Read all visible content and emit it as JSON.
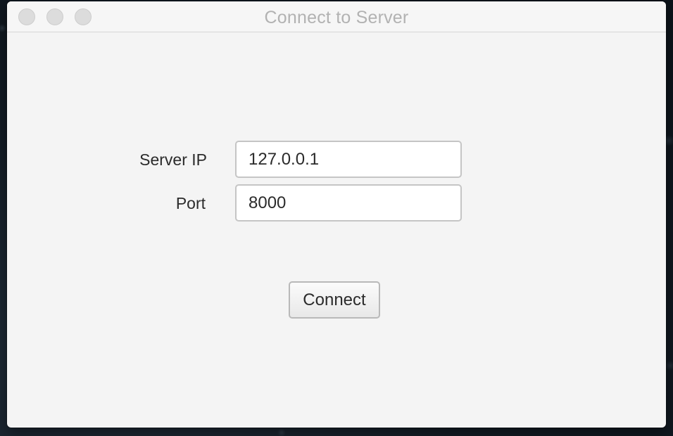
{
  "window": {
    "title": "Connect to Server",
    "controls": [
      "close",
      "minimize",
      "zoom"
    ]
  },
  "form": {
    "server_ip": {
      "label": "Server IP",
      "value": "127.0.0.1"
    },
    "port": {
      "label": "Port",
      "value": "8000"
    },
    "connect_label": "Connect"
  },
  "colors": {
    "window_background": "#f4f4f4",
    "title_text": "#b2b2b2",
    "traffic_light_inactive": "#dcdcdc",
    "text": "#2b2b2b"
  }
}
